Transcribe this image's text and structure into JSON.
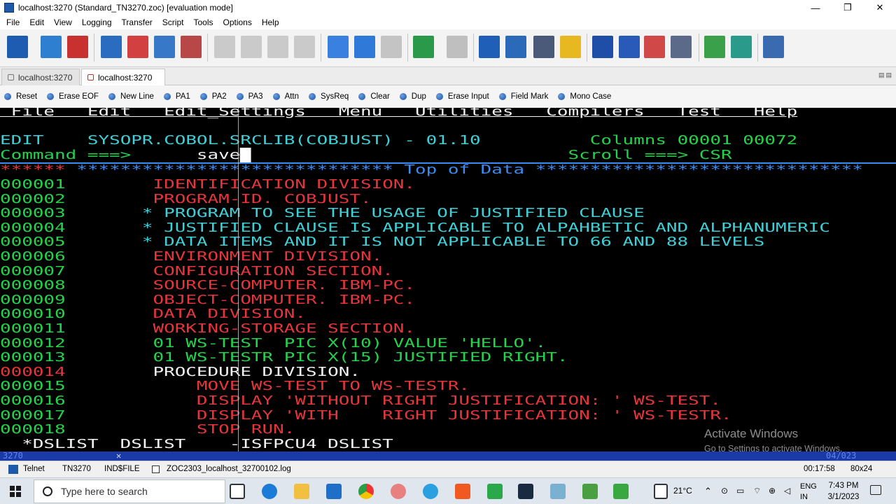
{
  "window": {
    "title": "localhost:3270 (Standard_TN3270.zoc) [evaluation mode]",
    "minimize": "—",
    "maximize": "❐",
    "close": "✕"
  },
  "menu": [
    "File",
    "Edit",
    "View",
    "Logging",
    "Transfer",
    "Script",
    "Tools",
    "Options",
    "Help"
  ],
  "toolbar_icons": [
    "sort-az-icon",
    "connect-icon",
    "disconnect-icon",
    "open-session-icon",
    "close-session-icon",
    "copy-session-icon",
    "delete-session-icon",
    "copy-icon",
    "paste-icon",
    "print-icon",
    "clear-icon",
    "download-icon",
    "upload-icon",
    "abc-icon",
    "run-script-icon",
    "stop-icon",
    "crosshair-icon",
    "target-icon",
    "print-screen-icon",
    "folder-icon",
    "terminal-icon",
    "font-icon",
    "color-icon",
    "options-icon",
    "tools-icon",
    "font-settings-icon",
    "close-window-icon"
  ],
  "tabs": [
    {
      "label": "localhost:3270",
      "active": false
    },
    {
      "label": "localhost:3270",
      "active": true
    }
  ],
  "keys": [
    "Reset",
    "Erase EOF",
    "New Line",
    "PA1",
    "PA2",
    "PA3",
    "Attn",
    "SysReq",
    "Clear",
    "Dup",
    "Erase Input",
    "Field Mark",
    "Mono Case"
  ],
  "terminal": {
    "menu_line": " File   Edit   Edit_Settings   Menu   Utilities   Compilers   Test   Help",
    "edit_label": "EDIT",
    "dataset": "SYSOPR.COBOL.SRCLIB(COBJUST) - 01.10",
    "columns": "Columns 00001 00072",
    "command_label": "Command ===>",
    "command_value": "save",
    "scroll": "Scroll ===> CSR",
    "top_marker": "******",
    "top_stars_left": " ***************************** ",
    "top_text": "Top of Data",
    "top_stars_right": " ******************************",
    "lines": [
      {
        "num": "000001",
        "num_color": "g",
        "text": "        IDENTIFICATION DIVISION.",
        "color": "r"
      },
      {
        "num": "000002",
        "num_color": "g",
        "text": "        PROGRAM-ID. COBJUST.",
        "color": "r"
      },
      {
        "num": "000003",
        "num_color": "g",
        "text": "       * PROGRAM TO SEE THE USAGE OF JUSTIFIED CLAUSE",
        "color": "c"
      },
      {
        "num": "000004",
        "num_color": "g",
        "text": "       * JUSTIFIED CLAUSE IS APPLICABLE TO ALPAHBETIC AND ALPHANUMERIC",
        "color": "c"
      },
      {
        "num": "000005",
        "num_color": "g",
        "text": "       * DATA ITEMS AND IT IS NOT APPLICABLE TO 66 AND 88 LEVELS",
        "color": "c"
      },
      {
        "num": "000006",
        "num_color": "g",
        "text": "        ENVIRONMENT DIVISION.",
        "color": "r"
      },
      {
        "num": "000007",
        "num_color": "g",
        "text": "        CONFIGURATION SECTION.",
        "color": "r"
      },
      {
        "num": "000008",
        "num_color": "g",
        "text": "        SOURCE-COMPUTER. IBM-PC.",
        "color": "r"
      },
      {
        "num": "000009",
        "num_color": "g",
        "text": "        OBJECT-COMPUTER. IBM-PC.",
        "color": "r"
      },
      {
        "num": "000010",
        "num_color": "g",
        "text": "        DATA DIVISION.",
        "color": "r"
      },
      {
        "num": "000011",
        "num_color": "g",
        "text": "        WORKING-STORAGE SECTION.",
        "color": "r"
      },
      {
        "num": "000012",
        "num_color": "g",
        "text": "        01 WS-TEST  PIC X(10) VALUE 'HELLO'.",
        "color": "g"
      },
      {
        "num": "000013",
        "num_color": "g",
        "text": "        01 WS-TESTR PIC X(15) JUSTIFIED RIGHT.",
        "color": "g"
      },
      {
        "num": "000014",
        "num_color": "r",
        "text": "        PROCEDURE DIVISION.",
        "color": "w"
      },
      {
        "num": "000015",
        "num_color": "g",
        "text": "            MOVE WS-TEST TO WS-TESTR.",
        "color": "r"
      },
      {
        "num": "000016",
        "num_color": "g",
        "text": "            DISPLAY 'WITHOUT RIGHT JUSTIFICATION: ' WS-TEST.",
        "color": "r"
      },
      {
        "num": "000017",
        "num_color": "g",
        "text": "            DISPLAY 'WITH    RIGHT JUSTIFICATION: ' WS-TESTR.",
        "color": "r"
      },
      {
        "num": "000018",
        "num_color": "g",
        "text": "            STOP RUN.",
        "color": "r"
      }
    ],
    "pfkey_line": "  *DSLIST  DSLIST    -ISFPCU4 DSLIST"
  },
  "oia": {
    "left": "3270",
    "right": "04/023"
  },
  "watermark": {
    "title": "Activate Windows",
    "subtitle": "Go to Settings to activate Windows."
  },
  "statusbar": {
    "protocol": "Telnet",
    "emulation": "TN3270",
    "transfer": "IND$FILE",
    "logfile": "ZOC2303_localhost_32700102.log",
    "elapsed": "00:17:58",
    "size": "80x24"
  },
  "taskbar": {
    "search_placeholder": "Type here to search",
    "temperature": "21°C",
    "language": "ENG",
    "region": "IN",
    "time": "7:43 PM",
    "date": "3/1/2023"
  },
  "colors": {
    "green": "#22d44a",
    "cyan": "#3ed0d8",
    "red": "#e8353a",
    "white": "#f2f2f2",
    "blue": "#3a8cf0"
  }
}
